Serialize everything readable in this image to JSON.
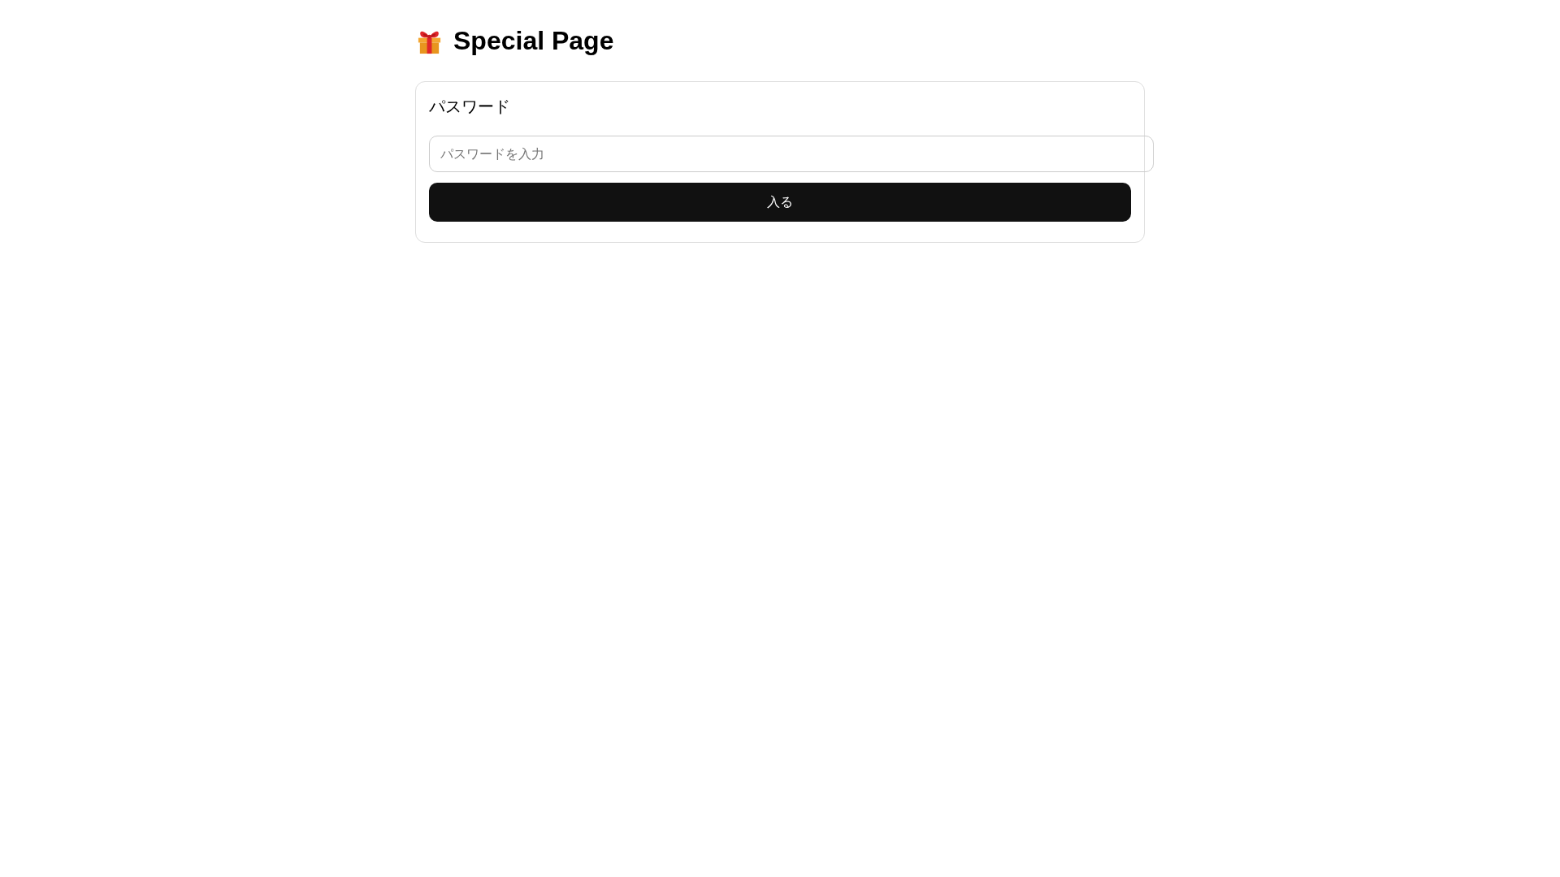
{
  "page": {
    "title": "Special Page"
  },
  "form": {
    "label": "パスワード",
    "password": {
      "placeholder": "パスワードを入力"
    },
    "submit": {
      "label": "入る"
    }
  }
}
